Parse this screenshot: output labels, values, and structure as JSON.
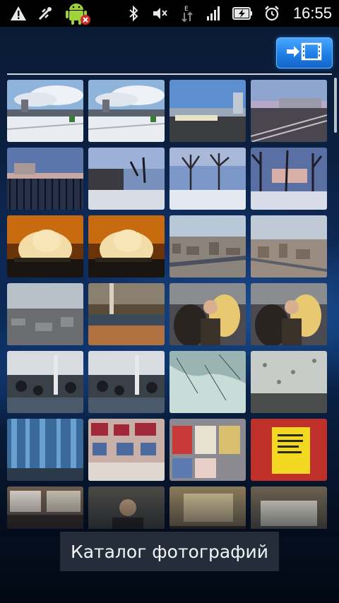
{
  "status_bar": {
    "time": "16:55",
    "left_icons": [
      "warning-icon",
      "usb-debug-icon",
      "android-app-icon"
    ],
    "right_icons": [
      "bluetooth-icon",
      "muted-icon",
      "data-transfer-icon",
      "signal-icon",
      "battery-charging-icon",
      "alarm-icon"
    ]
  },
  "toolbar": {
    "slideshow_icon": "slideshow-icon"
  },
  "gallery": {
    "thumbnails": [
      {
        "name": "thumb-snow-park-1",
        "scene": "snow-park"
      },
      {
        "name": "thumb-snow-park-2",
        "scene": "snow-park"
      },
      {
        "name": "thumb-station-platform",
        "scene": "platform"
      },
      {
        "name": "thumb-railway-dusk",
        "scene": "rail-dusk"
      },
      {
        "name": "thumb-fence-dusk",
        "scene": "fence-dusk"
      },
      {
        "name": "thumb-street-dusk",
        "scene": "street-dusk"
      },
      {
        "name": "thumb-trees-dusk-1",
        "scene": "trees-dusk"
      },
      {
        "name": "thumb-trees-dusk-2",
        "scene": "trees-dusk2"
      },
      {
        "name": "thumb-cat-1",
        "scene": "cat"
      },
      {
        "name": "thumb-cat-2",
        "scene": "cat"
      },
      {
        "name": "thumb-city-panorama-1",
        "scene": "city"
      },
      {
        "name": "thumb-city-panorama-2",
        "scene": "city2"
      },
      {
        "name": "thumb-city-haze",
        "scene": "city-haze"
      },
      {
        "name": "thumb-terminal-hall",
        "scene": "terminal"
      },
      {
        "name": "thumb-people-blonde-1",
        "scene": "people"
      },
      {
        "name": "thumb-people-blonde-2",
        "scene": "people"
      },
      {
        "name": "thumb-crowd-hall-1",
        "scene": "crowd"
      },
      {
        "name": "thumb-crowd-hall-2",
        "scene": "crowd"
      },
      {
        "name": "thumb-frosted-glass-1",
        "scene": "frost"
      },
      {
        "name": "thumb-frosted-glass-2",
        "scene": "frost2"
      },
      {
        "name": "thumb-blue-curtain",
        "scene": "curtain"
      },
      {
        "name": "thumb-store-shelves",
        "scene": "shelves"
      },
      {
        "name": "thumb-magazine-rack",
        "scene": "magazines"
      },
      {
        "name": "thumb-yellow-poster",
        "scene": "poster"
      },
      {
        "name": "thumb-room-1",
        "scene": "room"
      },
      {
        "name": "thumb-portrait",
        "scene": "portrait"
      },
      {
        "name": "thumb-room-2",
        "scene": "room2"
      },
      {
        "name": "thumb-room-3",
        "scene": "room3"
      }
    ]
  },
  "bottom_title": "Каталог фотографий"
}
